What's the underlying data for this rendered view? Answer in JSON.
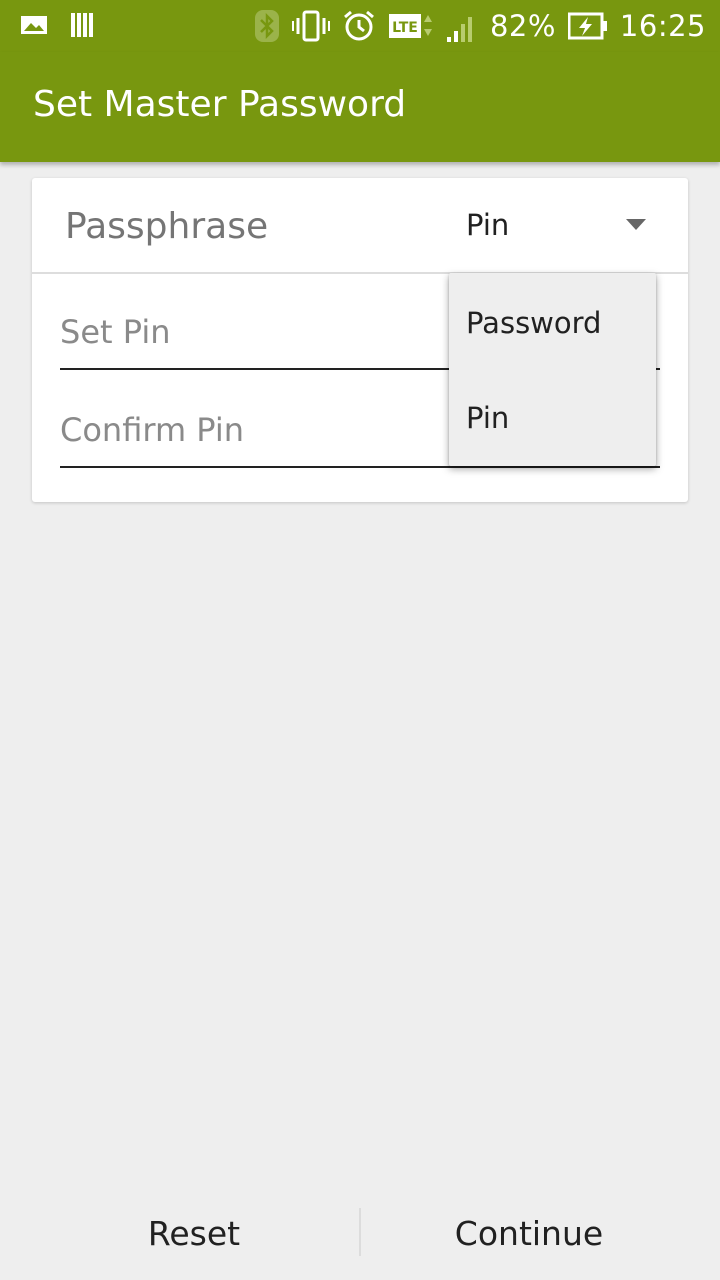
{
  "status_bar": {
    "battery": "82%",
    "time": "16:25",
    "icons": [
      "image-notification-icon",
      "barcode-notification-icon",
      "bluetooth-icon",
      "vibrate-icon",
      "alarm-icon",
      "lte-icon",
      "signal-icon",
      "battery-charging-icon"
    ],
    "lte_label": "LTE"
  },
  "toolbar": {
    "title": "Set Master Password"
  },
  "card": {
    "mode_label": "Passphrase",
    "mode_selected": "Pin",
    "set_pin_placeholder": "Set Pin",
    "confirm_pin_placeholder": "Confirm Pin"
  },
  "dropdown": {
    "options": [
      "Password",
      "Pin"
    ]
  },
  "bottom": {
    "reset_label": "Reset",
    "continue_label": "Continue"
  },
  "colors": {
    "primary": "#78970f",
    "background": "#eeeeee"
  }
}
